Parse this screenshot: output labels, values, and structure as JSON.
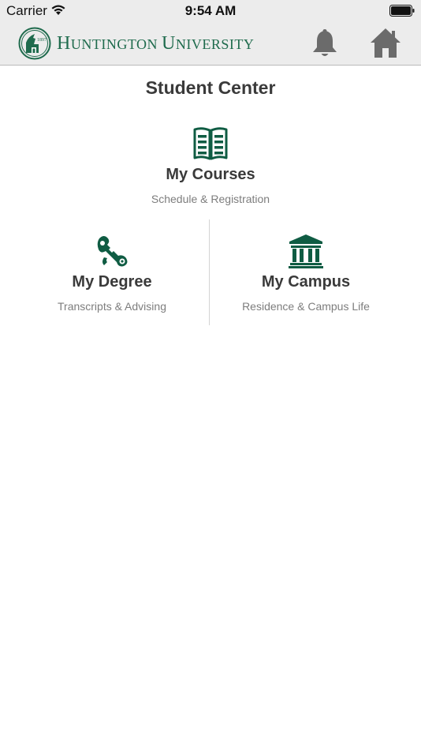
{
  "status_bar": {
    "carrier": "Carrier",
    "time": "9:54 AM"
  },
  "nav": {
    "logo_year": "1897",
    "logo_text_first_h": "H",
    "logo_text_rest1": "UNTINGTON ",
    "logo_text_first_u": "U",
    "logo_text_rest2": "NIVERSITY",
    "icons": [
      "bell-icon",
      "home-icon"
    ]
  },
  "main": {
    "title": "Student Center",
    "tiles": [
      {
        "title": "My Courses",
        "subtitle": "Schedule & Registration",
        "icon": "open-book-icon"
      },
      {
        "title": "My Degree",
        "subtitle": "Transcripts & Advising",
        "icon": "diploma-scroll-icon"
      },
      {
        "title": "My Campus",
        "subtitle": "Residence & Campus Life",
        "icon": "campus-building-icon"
      }
    ]
  },
  "colors": {
    "brand_green": "#1f6b4d",
    "icon_green": "#0f5c43",
    "nav_icon_gray": "#6b6b6b",
    "bar_background": "#ececec"
  }
}
